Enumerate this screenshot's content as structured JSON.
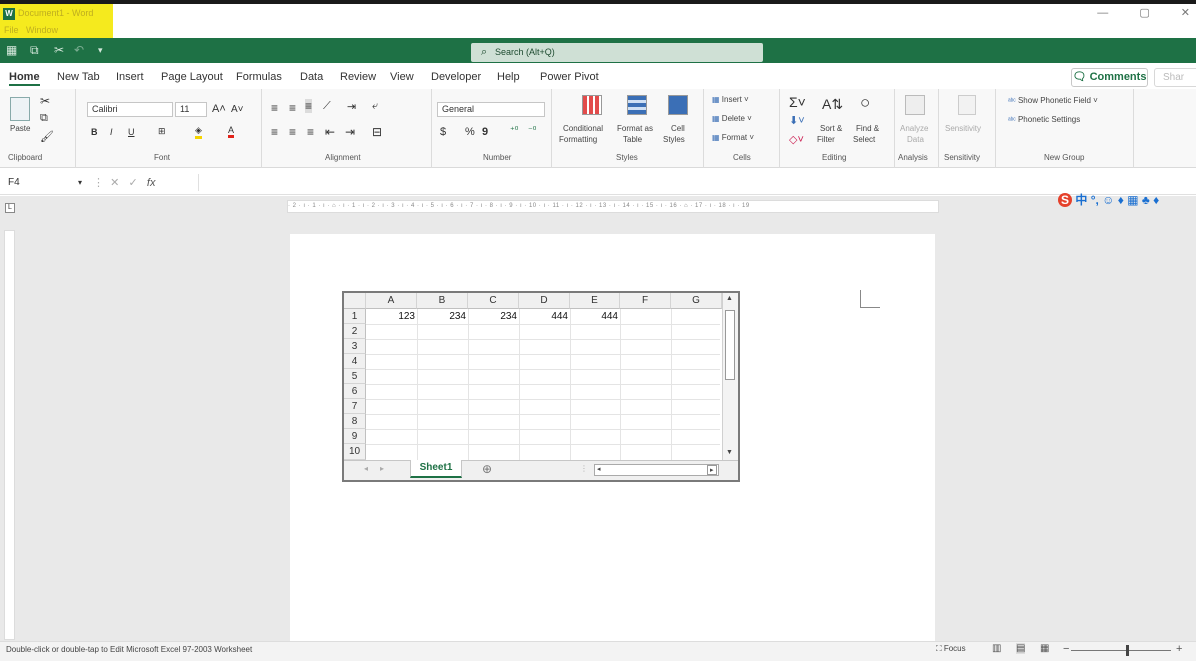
{
  "window": {
    "title": "Document1 - Word",
    "menu": [
      "File",
      "Window"
    ]
  },
  "search": {
    "placeholder": "Search (Alt+Q)"
  },
  "tabs": [
    "Home",
    "New Tab",
    "Insert",
    "Page Layout",
    "Formulas",
    "Data",
    "Review",
    "View",
    "Developer",
    "Help",
    "Power Pivot"
  ],
  "comments_label": "Comments",
  "share_label": "Shar",
  "ribbon": {
    "clipboard": {
      "label": "Clipboard",
      "paste": "Paste"
    },
    "font": {
      "label": "Font",
      "name": "Calibri",
      "size": "11",
      "bold": "B",
      "italic": "I",
      "underline": "U"
    },
    "alignment": {
      "label": "Alignment"
    },
    "number": {
      "label": "Number",
      "format": "General",
      "currency": "$",
      "percent": "%",
      "comma": "9"
    },
    "styles": {
      "label": "Styles",
      "conditional": [
        "Conditional",
        "Formatting"
      ],
      "table": [
        "Format as",
        "Table"
      ],
      "cell": [
        "Cell",
        "Styles"
      ]
    },
    "cells": {
      "label": "Cells",
      "insert": "Insert",
      "delete": "Delete",
      "format": "Format"
    },
    "editing": {
      "label": "Editing",
      "sort": [
        "Sort &",
        "Filter"
      ],
      "find": [
        "Find &",
        "Select"
      ]
    },
    "analysis": {
      "label": "Analysis",
      "analyze": [
        "Analyze",
        "Data"
      ]
    },
    "sensitivity": {
      "label": "Sensitivity",
      "button": "Sensitivity"
    },
    "newgroup": {
      "label": "New Group",
      "phonetic_field": "Show Phonetic Field",
      "phonetic_settings": "Phonetic Settings"
    }
  },
  "formula": {
    "namebox": "F4",
    "fx": "fx"
  },
  "ruler_text": "· 2 · ı · 1 · ı · ⌂ · ı · 1 · ı · 2 · ı · 3 · ı · 4 · ı · 5 · ı · 6 · ı · 7 · ı · 8 · ı · 9 · ı · 10 · ı · 11 · ı · 12 · ı · 13 · ı · 14 · ı · 15 · ı · 16 · ⌂ · 17 · ı · 18 · ı · 19",
  "sheet": {
    "columns": [
      "A",
      "B",
      "C",
      "D",
      "E",
      "F",
      "G"
    ],
    "rows": [
      "1",
      "2",
      "3",
      "4",
      "5",
      "6",
      "7",
      "8",
      "9",
      "10"
    ],
    "values": [
      "123",
      "234",
      "234",
      "444",
      "444"
    ],
    "tab": "Sheet1",
    "add": "⊕"
  },
  "ime": {
    "s": "S",
    "rest": "中 °, ☺ ♦ ▦ ♣ ♦"
  },
  "status": {
    "text": "Double-click or double-tap to Edit Microsoft Excel 97-2003 Worksheet",
    "focus": "Focus",
    "minus": "−",
    "plus": "+"
  },
  "colors": {
    "brand": "#1e7145",
    "highlight": "#f5ea1e"
  }
}
